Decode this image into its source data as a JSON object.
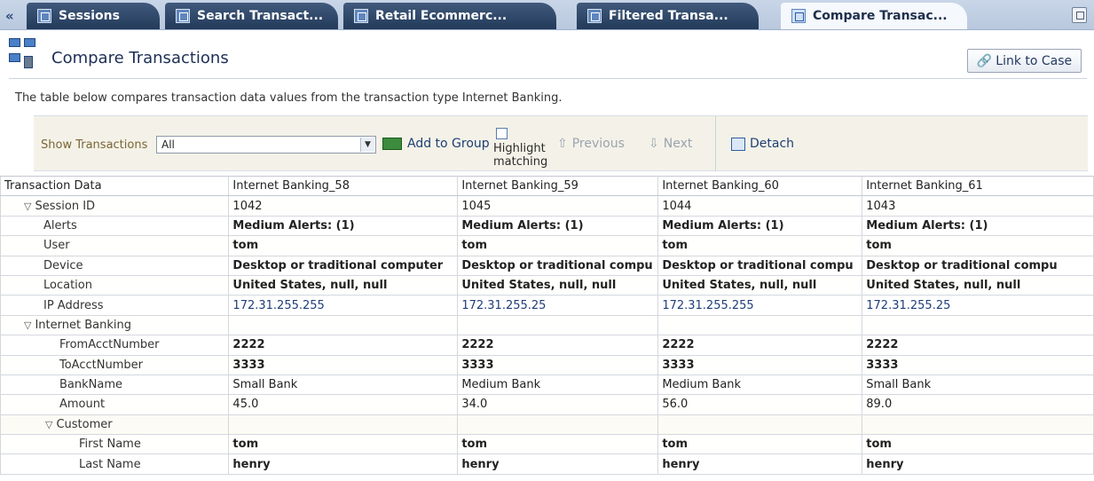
{
  "tabs": [
    {
      "label": "Sessions",
      "active": false
    },
    {
      "label": "Search Transact...",
      "active": false
    },
    {
      "label": "Retail Ecommerc...",
      "active": false
    },
    {
      "label": "Filtered Transa...",
      "active": false
    },
    {
      "label": "Compare Transac...",
      "active": true
    }
  ],
  "header": {
    "title": "Compare Transactions",
    "link_to_case": "Link to Case",
    "description": "The table below compares transaction data values from the transaction type Internet Banking."
  },
  "toolbar": {
    "show_label": "Show Transactions",
    "show_value": "All",
    "add_to_group": "Add to Group",
    "highlight_line1": "Highlight",
    "highlight_line2": "matching",
    "previous": "Previous",
    "next": "Next",
    "detach": "Detach"
  },
  "grid": {
    "header": [
      "Transaction Data",
      "Internet Banking_58",
      "Internet Banking_59",
      "Internet Banking_60",
      "Internet Banking_61"
    ],
    "rows": [
      {
        "label": "Session ID",
        "values": [
          "1042",
          "1045",
          "1044",
          "1043"
        ]
      },
      {
        "label": "Alerts",
        "values": [
          "Medium Alerts: (1)",
          "Medium Alerts: (1)",
          "Medium Alerts: (1)",
          "Medium Alerts: (1)"
        ]
      },
      {
        "label": "User",
        "values": [
          "tom",
          "tom",
          "tom",
          "tom"
        ]
      },
      {
        "label": "Device",
        "values": [
          "Desktop or traditional computer",
          "Desktop or traditional compu",
          "Desktop or traditional compu",
          "Desktop or traditional compu"
        ]
      },
      {
        "label": "Location",
        "values": [
          "United States, null, null",
          "United States, null, null",
          "United States, null, null",
          "United States, null, null"
        ]
      },
      {
        "label": "IP Address",
        "values": [
          "172.31.255.255",
          "172.31.255.25",
          "172.31.255.255",
          "172.31.255.25"
        ]
      },
      {
        "label": "Internet Banking",
        "values": [
          "",
          "",
          "",
          ""
        ]
      },
      {
        "label": "FromAcctNumber",
        "values": [
          "2222",
          "2222",
          "2222",
          "2222"
        ]
      },
      {
        "label": "ToAcctNumber",
        "values": [
          "3333",
          "3333",
          "3333",
          "3333"
        ]
      },
      {
        "label": "BankName",
        "values": [
          "Small Bank",
          "Medium Bank",
          "Medium Bank",
          "Small Bank"
        ]
      },
      {
        "label": "Amount",
        "values": [
          "45.0",
          "34.0",
          "56.0",
          "89.0"
        ]
      },
      {
        "label": "Customer",
        "values": [
          "",
          "",
          "",
          ""
        ]
      },
      {
        "label": "First Name",
        "values": [
          "tom",
          "tom",
          "tom",
          "tom"
        ]
      },
      {
        "label": "Last Name",
        "values": [
          "henry",
          "henry",
          "henry",
          "henry"
        ]
      }
    ]
  }
}
